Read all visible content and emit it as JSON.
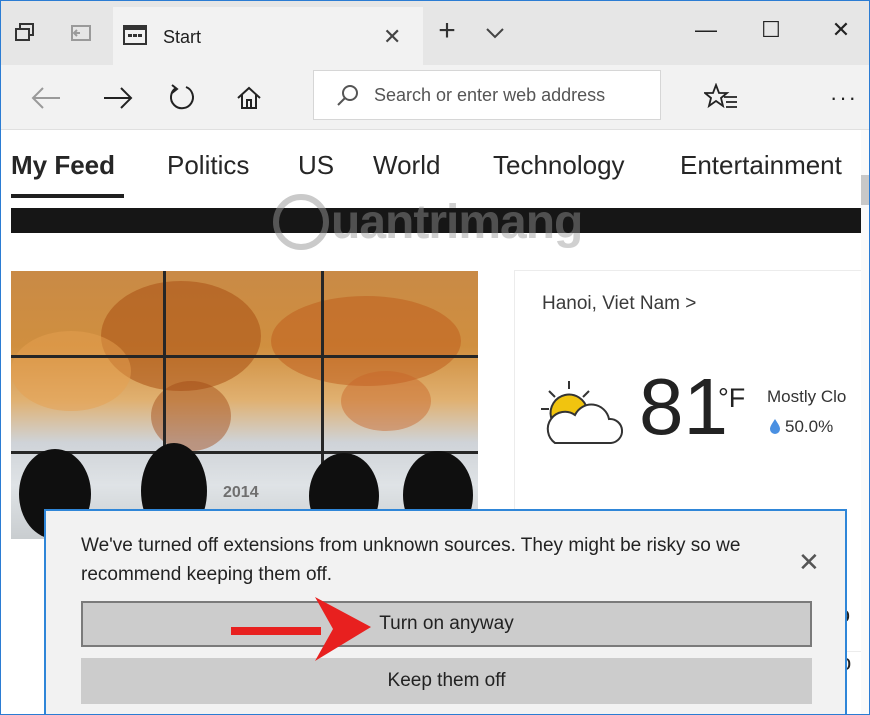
{
  "tab": {
    "title": "Start"
  },
  "addressbar": {
    "placeholder": "Search or enter web address"
  },
  "feed": {
    "tabs": [
      "My Feed",
      "Politics",
      "US",
      "World",
      "Technology",
      "Entertainment"
    ]
  },
  "hero": {
    "year_text": "2014"
  },
  "weather": {
    "location": "Hanoi, Viet Nam >",
    "temperature": "81",
    "unit": "°F",
    "condition": "Mostly Clo",
    "precipitation": "50.0%"
  },
  "notification": {
    "message": "We've turned off extensions from unknown sources. They might be risky so we recommend keeping them off.",
    "primary_button": "Turn on anyway",
    "secondary_button": "Keep them off"
  },
  "watermark": "Quantrimang",
  "colors": {
    "accent": "#2f86d8",
    "arrow": "#e8201f"
  }
}
